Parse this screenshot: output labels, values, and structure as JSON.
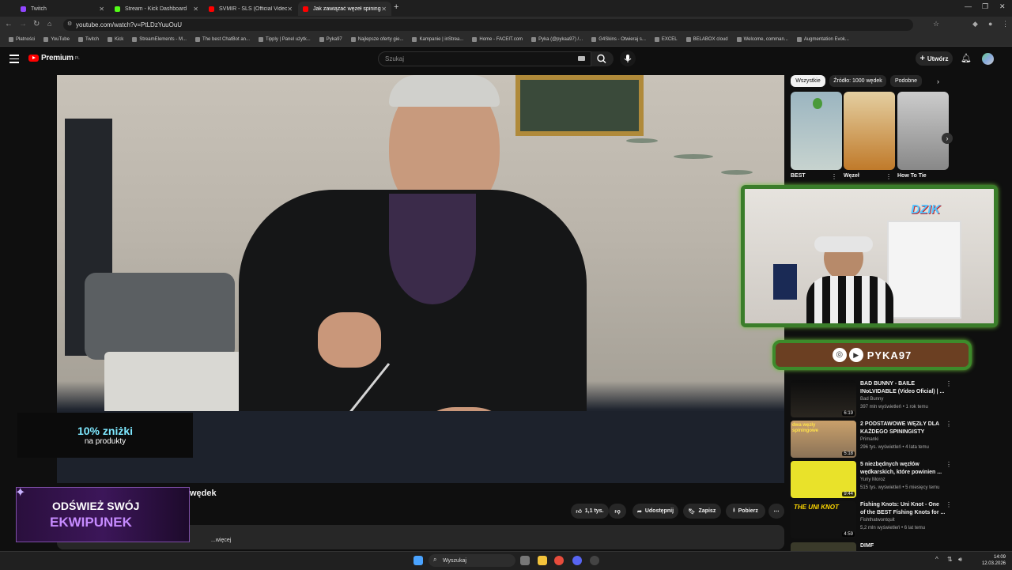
{
  "browser": {
    "tabs": [
      {
        "label": "Twitch",
        "color": "#9146ff"
      },
      {
        "label": "Stream - Kick Dashboard",
        "color": "#53fc18"
      },
      {
        "label": "SVMIR - SLS (Official Video) - Y",
        "color": "#ff0000"
      },
      {
        "label": "Jak zawiązać węzeł spiningowy",
        "color": "#ff0000"
      }
    ],
    "url": "youtube.com/watch?v=PtLDzYuuOuU",
    "bookmarks": [
      "Płatności",
      "YouTube",
      "Twitch",
      "Kick",
      "StreamElements - M...",
      "The best ChatBot an...",
      "Tipply | Panel użytk...",
      "Pyka97",
      "Najlepsze oferty gie...",
      "Kampanie | inStrea...",
      "Home - FACEIT.com",
      "Pyka (@pykaa97) /...",
      "G4Skins - Otwieraj s...",
      "EXCEL",
      "BELABOX cloud",
      "Welcome, comman...",
      "Augmentation Evok..."
    ]
  },
  "youtube": {
    "logo": "Premium",
    "logo_sup": "PL",
    "search_placeholder": "Szukaj",
    "create_label": "Utwórz",
    "video_title_visible": "wędek",
    "actions": {
      "likes": "1,1 tys.",
      "share": "Udostępnij",
      "save": "Zapisz",
      "download": "Pobierz"
    },
    "description_more": "...więcej",
    "chips": [
      "Wszystkie",
      "Źródło: 1000 wędek",
      "Podobne"
    ],
    "shorts": [
      {
        "title": "BEST"
      },
      {
        "title": "Węzeł"
      },
      {
        "title": "How To Tie"
      }
    ],
    "recommendations": [
      {
        "title": "BAD BUNNY - BAILE INoLVIDABLE (Video Oficial) | ...",
        "channel": "Bad Bunny",
        "meta": "397 mln wyświetleń • 1 rok temu",
        "duration": "6:19"
      },
      {
        "title": "2 PODSTAWOWE WĘZŁY DLA KAŻDEGO SPININGISTY",
        "channel": "Primanki",
        "meta": "296 tys. wyświetleń • 4 lata temu",
        "duration": "5:18"
      },
      {
        "title": "5 niezbędnych węzłów wędkarskich, które powinien ...",
        "channel": "Yuriy Moroz",
        "meta": "515 tys. wyświetleń • 5 miesięcy temu",
        "duration": "9:44"
      },
      {
        "title": "Fishing Knots: Uni Knot - One of the BEST Fishing Knots for ...",
        "channel": "Fishthatwontquit",
        "meta": "5,2 mln wyświetleń • 6 lat temu",
        "duration": "4:59"
      },
      {
        "title": "DIMF",
        "channel": "",
        "meta": "",
        "duration": ""
      }
    ],
    "rec_thumb_texts": [
      "dwa węzły spiningowe",
      "THE UNI KNOT"
    ]
  },
  "overlays": {
    "promo_line1": "10% zniżki",
    "promo_line2": "na produkty",
    "banner_line1": "ODŚWIEŻ SWÓJ",
    "banner_line2": "EKWIPUNEK",
    "social_handle": "PYKA97",
    "cam_logo": "DZIK"
  },
  "taskbar": {
    "search_placeholder": "Wyszukaj",
    "time": "14:09",
    "date": "12.03.2026"
  }
}
